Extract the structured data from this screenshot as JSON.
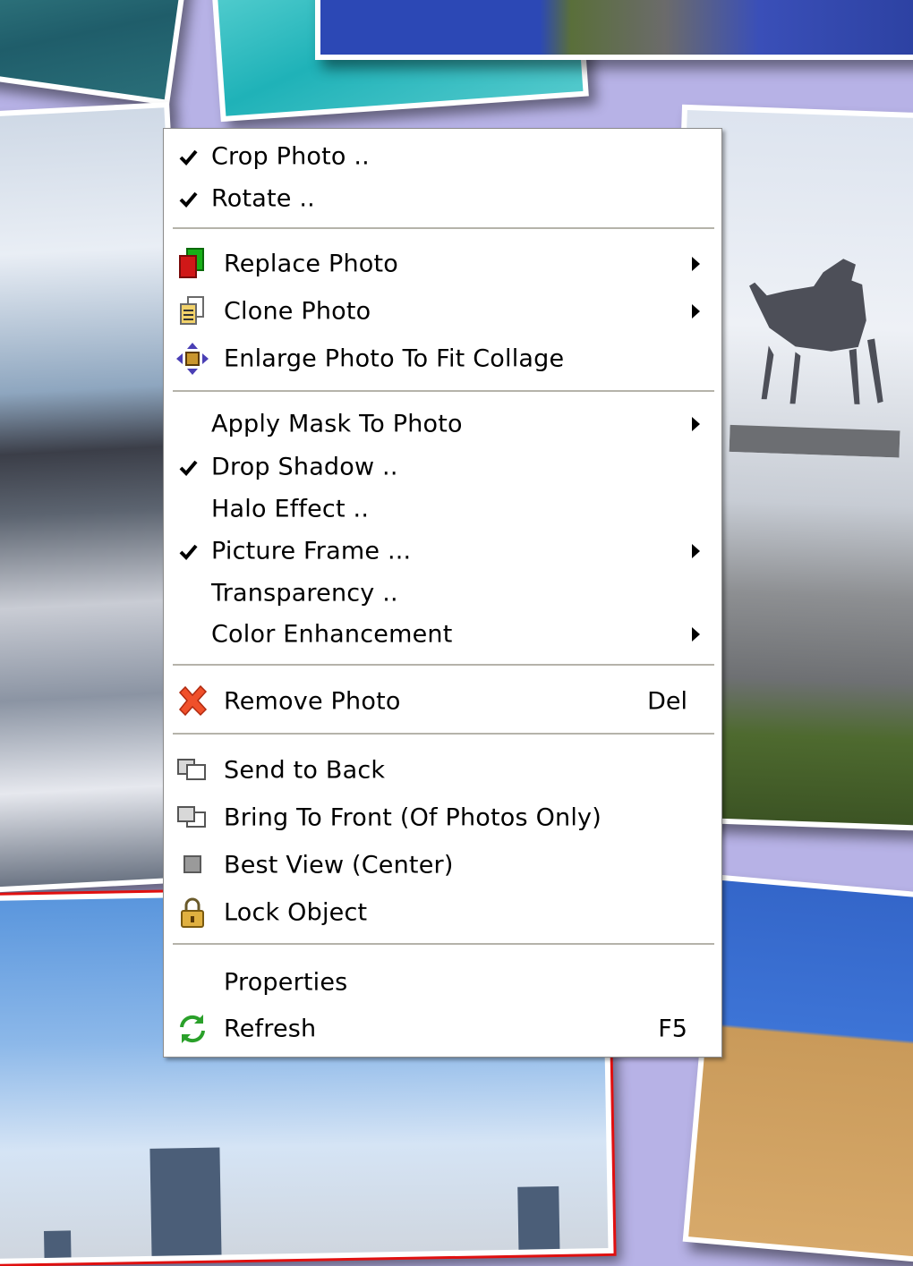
{
  "menu": {
    "crop_photo": "Crop Photo ..",
    "rotate": "Rotate ..",
    "replace_photo": "Replace Photo",
    "clone_photo": "Clone Photo",
    "enlarge_photo": "Enlarge Photo To Fit Collage",
    "apply_mask": "Apply Mask To Photo",
    "drop_shadow": "Drop Shadow ..",
    "halo_effect": "Halo Effect ..",
    "picture_frame": "Picture Frame ...",
    "transparency": "Transparency ..",
    "color_enhancement": "Color Enhancement",
    "remove_photo": "Remove Photo",
    "remove_shortcut": "Del",
    "send_to_back": "Send to Back",
    "bring_to_front": "Bring To Front (Of Photos Only)",
    "best_view": "Best View (Center)",
    "lock_object": "Lock Object",
    "properties": "Properties",
    "refresh": "Refresh",
    "refresh_shortcut": "F5"
  },
  "checked": {
    "crop_photo": true,
    "rotate": true,
    "drop_shadow": true,
    "picture_frame": true
  },
  "icons": {
    "check": "checkmark-icon",
    "replace": "replace-photo-icon",
    "clone": "clone-photo-icon",
    "enlarge": "enlarge-arrows-icon",
    "remove": "red-x-icon",
    "send_back": "send-to-back-icon",
    "bring_front": "bring-to-front-icon",
    "best_view": "gray-square-icon",
    "lock": "padlock-icon",
    "refresh": "green-refresh-icon",
    "submenu": "submenu-arrow-icon"
  },
  "colors": {
    "collage_background": "#b7b2e6",
    "selection_border": "#e01010",
    "menu_background": "#ffffff"
  }
}
